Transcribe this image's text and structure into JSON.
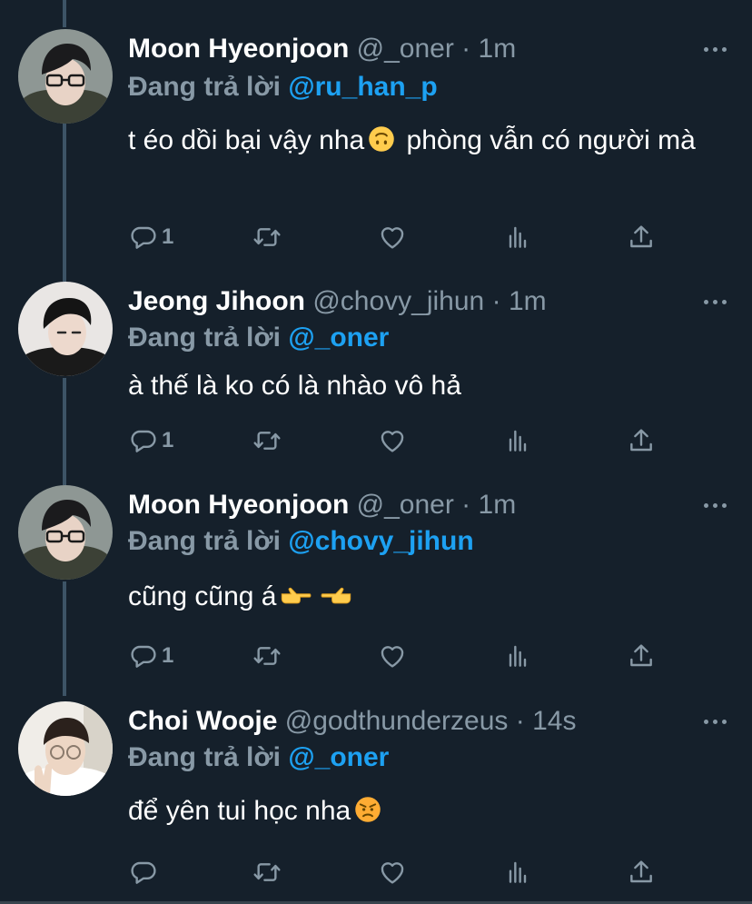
{
  "colors": {
    "background": "#15202b",
    "secondary_text": "#8899a6",
    "mention": "#1da1f2",
    "thread_line": "#3d5466"
  },
  "icons": {
    "reply": "reply-icon",
    "retweet": "retweet-icon",
    "like": "heart-icon",
    "analytics": "analytics-icon",
    "share": "share-icon",
    "more": "more-icon"
  },
  "tweets": [
    {
      "name": "Moon Hyeonjoon",
      "handle": "@_oner",
      "separator": "·",
      "time": "1m",
      "reply_prefix": "Đang trả lời",
      "reply_to": "@ru_han_p",
      "text_part1": "t éo dồi bại vậy nha",
      "emoji1": "upside-down-face-emoji",
      "text_part2": "phòng vẫn có người mà",
      "reply_count": "1"
    },
    {
      "name": "Jeong Jihoon",
      "handle": "@chovy_jihun",
      "separator": "·",
      "time": "1m",
      "reply_prefix": "Đang trả lời",
      "reply_to": "@_oner",
      "text": "à thế là ko có là nhào vô hả",
      "reply_count": "1"
    },
    {
      "name": "Moon Hyeonjoon",
      "handle": "@_oner",
      "separator": "·",
      "time": "1m",
      "reply_prefix": "Đang trả lời",
      "reply_to": "@chovy_jihun",
      "text": "cũng cũng á",
      "emoji1": "pointing-right-emoji",
      "emoji2": "pointing-left-emoji",
      "reply_count": "1"
    },
    {
      "name": "Choi Wooje",
      "handle": "@godthunderzeus",
      "separator": "·",
      "time": "14s",
      "reply_prefix": "Đang trả lời",
      "reply_to": "@_oner",
      "text": "để yên tui học nha",
      "emoji1": "angry-face-emoji",
      "reply_count": ""
    }
  ]
}
